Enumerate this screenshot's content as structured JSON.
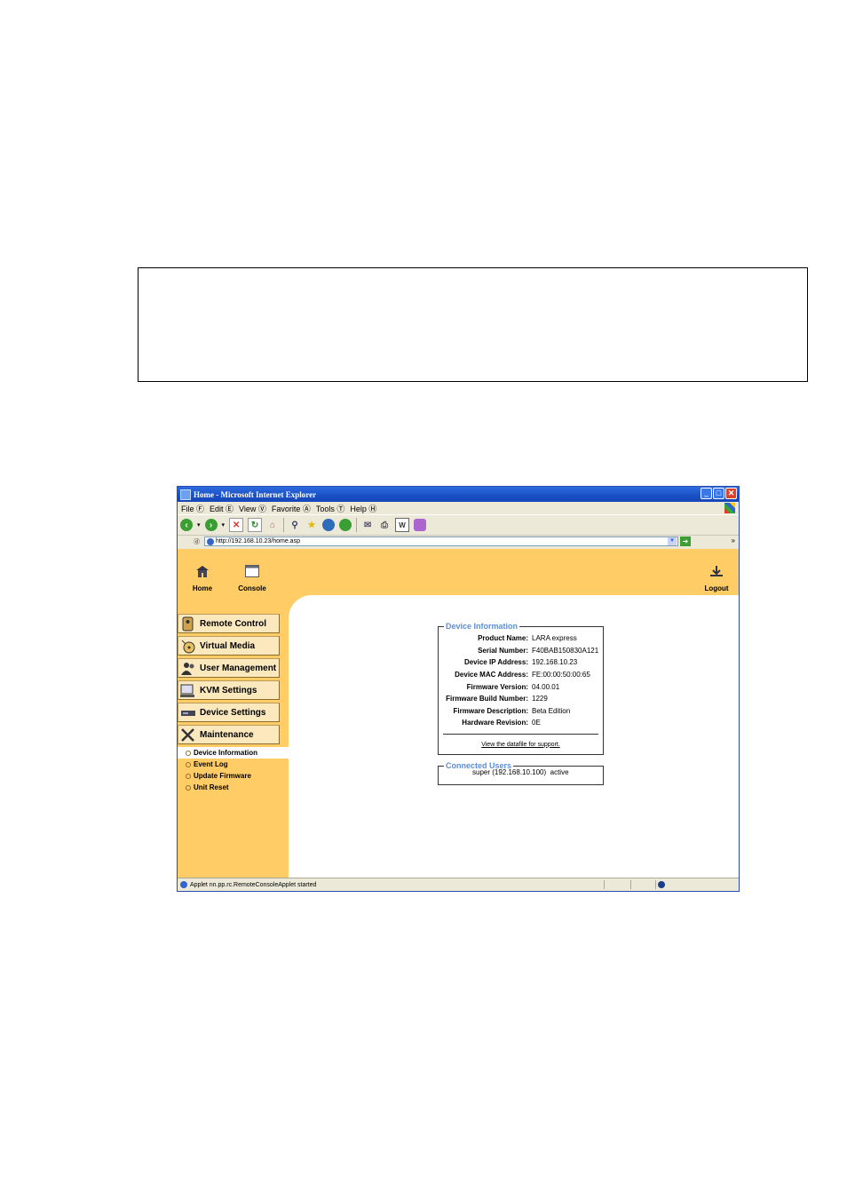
{
  "window": {
    "title": "Home - Microsoft Internet Explorer",
    "controls": [
      "minimize",
      "maximize",
      "close"
    ]
  },
  "menubar": {
    "items": [
      "File Ⓕ",
      "Edit Ⓔ",
      "View Ⓥ",
      "Favorite Ⓐ",
      "Tools Ⓣ",
      "Help Ⓗ"
    ]
  },
  "toolbar": {
    "icons": [
      "back-icon",
      "forward-icon",
      "stop-icon",
      "refresh-icon",
      "home-icon",
      "search-icon",
      "favorites-icon",
      "media-icon",
      "history-icon",
      "mail-icon",
      "print-icon",
      "edit-icon",
      "messenger-icon"
    ]
  },
  "address": {
    "label": "ⓓ",
    "url": "http://192.168.10.23/home.asp"
  },
  "topnav": {
    "home": "Home",
    "console": "Console",
    "logout": "Logout"
  },
  "sidebar": {
    "buttons": [
      "Remote Control",
      "Virtual Media",
      "User Management",
      "KVM Settings",
      "Device Settings",
      "Maintenance"
    ],
    "subitems": [
      "Device Information",
      "Event Log",
      "Update Firmware",
      "Unit Reset"
    ]
  },
  "device_info": {
    "legend": "Device Information",
    "rows": [
      {
        "label": "Product Name:",
        "value": "LARA express"
      },
      {
        "label": "Serial Number:",
        "value": "F40BAB150830A121"
      },
      {
        "label": "Device IP Address:",
        "value": "192.168.10.23"
      },
      {
        "label": "Device MAC Address:",
        "value": "FE:00:00:50:00:65"
      },
      {
        "label": "Firmware Version:",
        "value": "04.00.01"
      },
      {
        "label": "Firmware Build Number:",
        "value": "1229"
      },
      {
        "label": "Firmware Description:",
        "value": "Beta Edition"
      },
      {
        "label": "Hardware Revision:",
        "value": "0E"
      }
    ],
    "link": "View the datafile for support."
  },
  "connected_users": {
    "legend": "Connected Users",
    "entry": "super (192.168.10.100)  active"
  },
  "statusbar": {
    "text": "Applet nn.pp.rc.RemoteConsoleApplet started"
  }
}
